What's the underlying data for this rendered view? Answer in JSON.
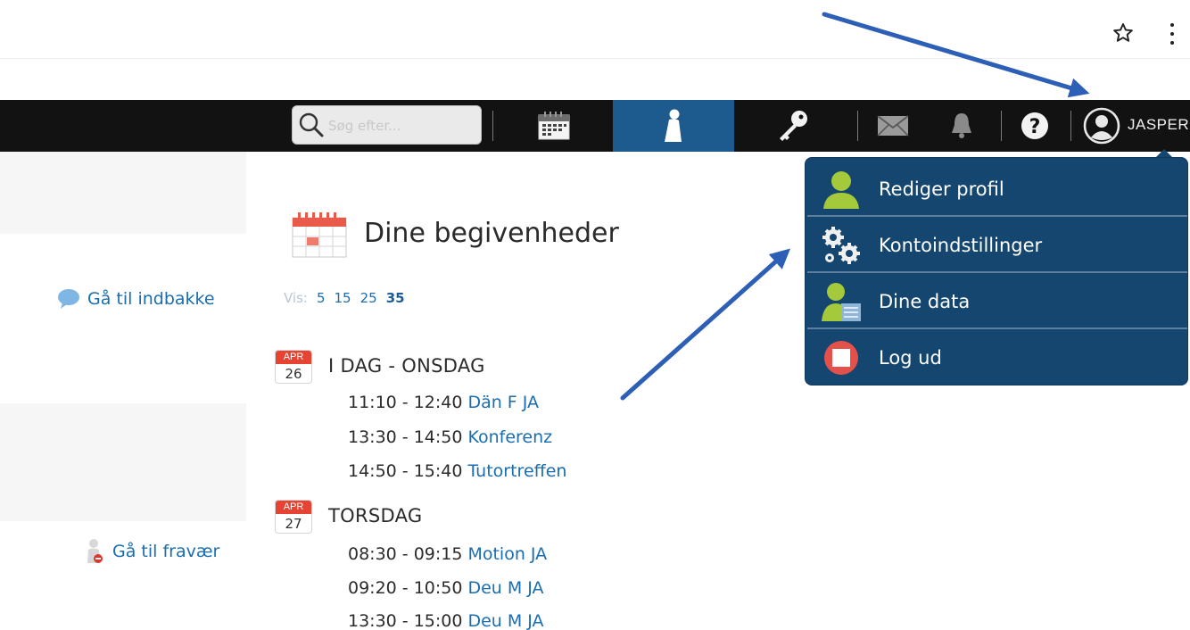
{
  "browser": {
    "bookmark_icon": "star-outline-icon",
    "menu_icon": "kebab-menu-icon"
  },
  "topnav": {
    "search": {
      "placeholder": "Søg efter..."
    },
    "items": [
      {
        "name": "calendar",
        "icon": "calendar-icon"
      },
      {
        "name": "profile",
        "icon": "person-icon",
        "active": true
      },
      {
        "name": "key",
        "icon": "key-icon"
      },
      {
        "name": "messages",
        "icon": "envelope-icon"
      },
      {
        "name": "notifications",
        "icon": "bell-icon"
      },
      {
        "name": "help",
        "icon": "help-icon"
      }
    ],
    "user": {
      "label": "JASPER",
      "icon": "user-avatar-icon"
    },
    "colors": {
      "bar": "#121212",
      "active": "#1d5a8e"
    }
  },
  "left": {
    "inbox_link": "Gå til indbakke",
    "absence_link": "Gå til fravær"
  },
  "events": {
    "title": "Dine begivenheder",
    "vis": {
      "label": "Vis:",
      "options": [
        "5",
        "15",
        "25",
        "35"
      ],
      "current": "35"
    },
    "days": [
      {
        "month": "APR",
        "day": "26",
        "label": "I DAG - ONSDAG",
        "items": [
          {
            "time": "11:10 - 12:40",
            "name": "Dän F JA"
          },
          {
            "time": "13:30 - 14:50",
            "name": "Konferenz"
          },
          {
            "time": "14:50 - 15:40",
            "name": "Tutortreffen"
          }
        ]
      },
      {
        "month": "APR",
        "day": "27",
        "label": "TORSDAG",
        "items": [
          {
            "time": "08:30 - 09:15",
            "name": "Motion JA"
          },
          {
            "time": "09:20 - 10:50",
            "name": "Deu M JA"
          },
          {
            "time": "13:30 - 15:00",
            "name": "Deu M JA"
          }
        ]
      }
    ]
  },
  "user_menu": {
    "items": [
      {
        "label": "Rediger profil",
        "icon": "user-green-icon"
      },
      {
        "label": "Kontoindstillinger",
        "icon": "gears-icon"
      },
      {
        "label": "Dine data",
        "icon": "user-data-icon"
      },
      {
        "label": "Log ud",
        "icon": "logout-icon"
      }
    ],
    "colors": {
      "background": "#14466f",
      "divider": "#5d7e9c"
    }
  },
  "annotation_color": "#2c5fb5"
}
